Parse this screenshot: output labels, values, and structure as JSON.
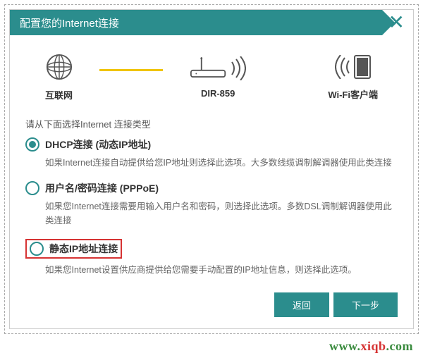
{
  "header": {
    "title": "配置您的Internet连接"
  },
  "diagram": {
    "internet_label": "互联网",
    "router_label": "DIR-859",
    "client_label": "Wi-Fi客户端"
  },
  "instruction": "请从下面选择Internet 连接类型",
  "options": [
    {
      "title": "DHCP连接 (动态IP地址)",
      "desc": "如果Internet连接自动提供给您IP地址则选择此选项。大多数线缆调制解调器使用此类连接",
      "selected": true
    },
    {
      "title": "用户名/密码连接 (PPPoE)",
      "desc": "如果您Internet连接需要用输入用户名和密码，则选择此选项。多数DSL调制解调器使用此类连接",
      "selected": false
    },
    {
      "title": "静态IP地址连接",
      "desc": "如果您Internet设置供应商提供给您需要手动配置的IP地址信息，则选择此选项。",
      "selected": false,
      "highlighted": true
    }
  ],
  "buttons": {
    "back": "返回",
    "next": "下一步"
  },
  "watermark": {
    "text1": "www.",
    "text2": "xiqb",
    "text3": ".com"
  }
}
